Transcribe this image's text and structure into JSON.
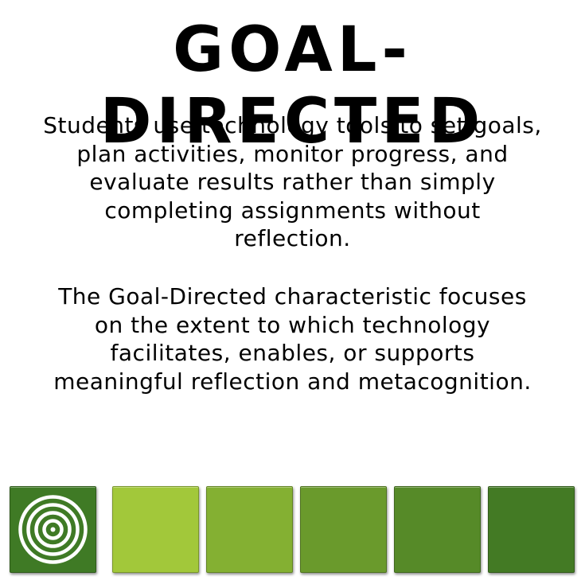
{
  "title": "GOAL-DIRECTED",
  "paragraph1": {
    "lines": [
      "Students use technology tools to set goals,",
      "plan activities, monitor progress, and",
      "evaluate results rather than simply",
      "completing assignments without",
      "reflection."
    ]
  },
  "paragraph2": {
    "lines": [
      "The Goal-Directed characteristic focuses",
      "on the extent to which technology",
      "facilitates, enables, or supports",
      "meaningful reflection and metacognition."
    ]
  },
  "tiles": [
    {
      "color": "#3f7a25",
      "icon": "target-icon"
    },
    {
      "color": "#a2c83a"
    },
    {
      "color": "#84b032"
    },
    {
      "color": "#6a9a2c"
    },
    {
      "color": "#568a28"
    },
    {
      "color": "#437a24"
    }
  ]
}
